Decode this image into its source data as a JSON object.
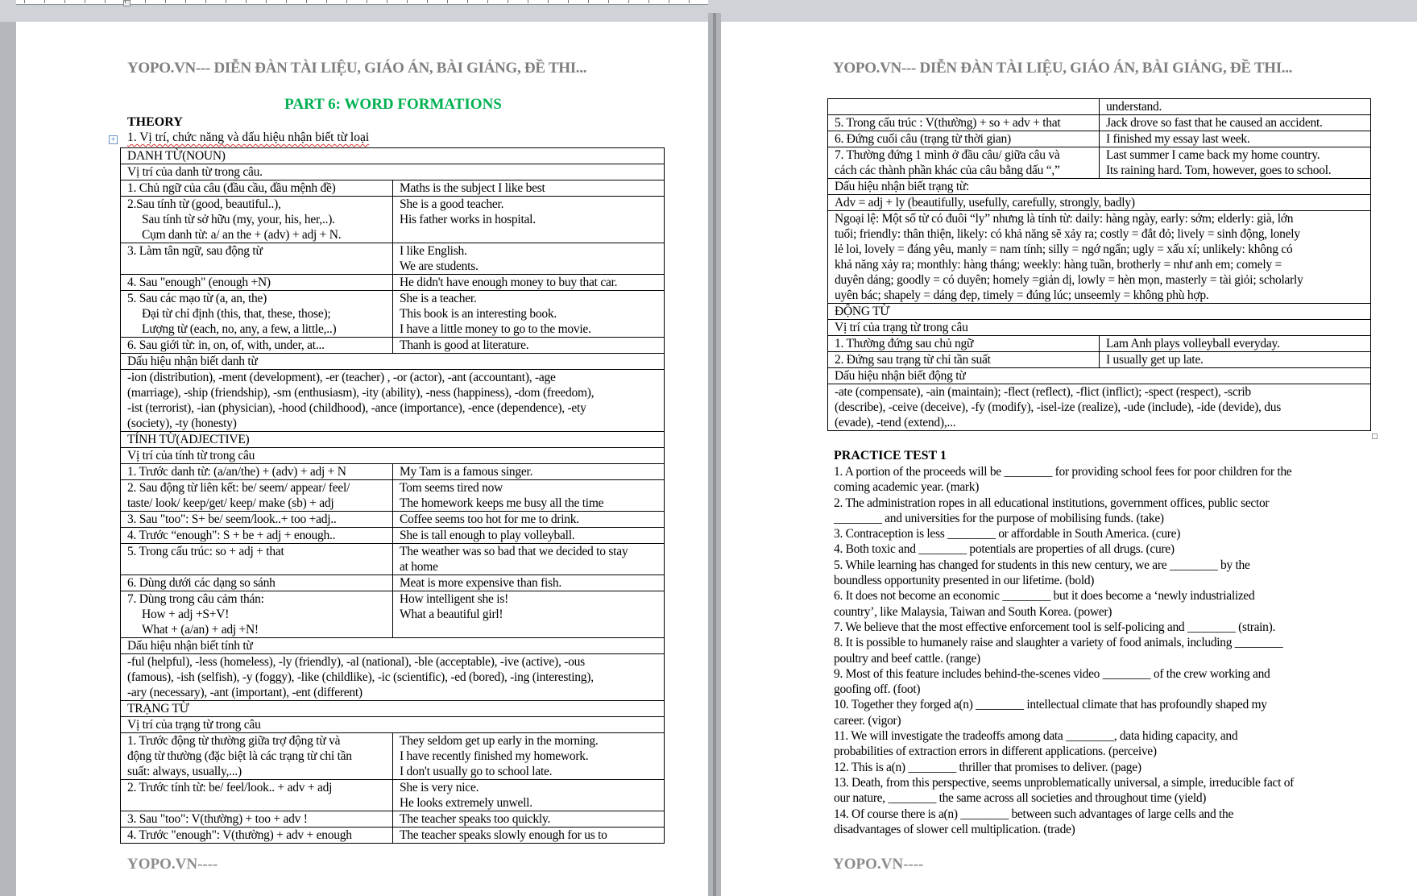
{
  "header_text": "YOPO.VN--- DIỄN ĐÀN TÀI LIỆU, GIÁO ÁN, BÀI GIẢNG, ĐỀ THI...",
  "footer_text": "YOPO.VN----",
  "colors": {
    "title_green": "#00b050",
    "header_gray": "#7f7f7f",
    "spell_underline": "#e03030"
  },
  "left_page": {
    "title": "PART 6: WORD FORMATIONS",
    "theory_label": "THEORY",
    "subheading": "1. Vị trí, chức năng và dấu hiệu nhận biết từ loại",
    "rows": [
      {
        "type": "full",
        "lines": [
          "DANH TỪ(NOUN)"
        ]
      },
      {
        "type": "full",
        "lines": [
          "Vị trí của danh từ trong câu."
        ]
      },
      {
        "type": "pair",
        "left": [
          "1. Chủ ngữ của câu (đầu cầu, đầu mệnh đề)"
        ],
        "right": [
          "Maths is the subject I like best"
        ]
      },
      {
        "type": "pair",
        "left": [
          "2.Sau tính từ (good, beautiful..),",
          "Sau tính từ sở hữu (my, your, his, her,..).",
          "Cụm danh từ: a/ an the + (adv) + adj + N."
        ],
        "right": [
          "She is a good teacher.",
          "His father works in hospital."
        ]
      },
      {
        "type": "pair",
        "left": [
          "3. Làm tân ngữ, sau động từ"
        ],
        "right": [
          "I like English.",
          "We are students."
        ]
      },
      {
        "type": "pair",
        "left": [
          "4. Sau \"enough\" (enough +N)"
        ],
        "right": [
          "He didn't have enough money to buy that car."
        ]
      },
      {
        "type": "pair",
        "left": [
          "5. Sau các mạo từ (a, an, the)",
          "Đại từ chỉ định (this, that, these, those);",
          "Lượng từ (each, no, any, a few, a little,..)"
        ],
        "right": [
          "She is a teacher.",
          "This book is an interesting book.",
          "I have a little money to go to the movie."
        ]
      },
      {
        "type": "pair",
        "left": [
          "6. Sau giới từ: in, on, of, with, under, at..."
        ],
        "right": [
          "Thanh is good at literature."
        ]
      },
      {
        "type": "full",
        "lines": [
          "Dấu hiệu nhận biết danh từ"
        ]
      },
      {
        "type": "full",
        "lines": [
          "-ion (distribution), -ment (development), -er (teacher) , -or (actor), -ant (accountant), -age",
          "(marriage), -ship (friendship), -sm (enthusiasm), -ity (ability), -ness (happiness), -dom (freedom),",
          "-ist (terrorist), -ian (physician), -hood (childhood), -ance (importance), -ence (dependence), -ety",
          "(society), -ty (honesty)"
        ]
      },
      {
        "type": "full",
        "lines": [
          "TÍNH TỪ(ADJECTIVE)"
        ]
      },
      {
        "type": "full",
        "lines": [
          "Vị trí của tính từ trong câu"
        ]
      },
      {
        "type": "pair",
        "left": [
          "1. Trước danh từ: (a/an/the) + (adv) + adj + N"
        ],
        "right": [
          "My Tam is a famous singer."
        ]
      },
      {
        "type": "pair",
        "left": [
          "2. Sau động từ liên kết: be/ seem/ appear/ feel/",
          "taste/ look/ keep/get/ keep/ make (sb) + adj"
        ],
        "right": [
          "Tom seems tired now",
          "The homework keeps me busy all the time"
        ]
      },
      {
        "type": "pair",
        "left": [
          "3. Sau \"too\": S+ be/ seem/look..+ too +adj.."
        ],
        "right": [
          "Coffee seems too hot for me to drink."
        ]
      },
      {
        "type": "pair",
        "left": [
          "4. Trước “enough\": S + be + adj + enough.."
        ],
        "right": [
          "She is tall enough to play volleyball."
        ]
      },
      {
        "type": "pair",
        "left": [
          "5. Trong cấu trúc: so + adj + that"
        ],
        "right": [
          "The weather was so bad that we decided to stay",
          "at home"
        ]
      },
      {
        "type": "pair",
        "left": [
          "6. Dùng dưới các dạng so sánh"
        ],
        "right": [
          "Meat is more expensive than fish."
        ]
      },
      {
        "type": "pair",
        "left": [
          "7. Dùng trong câu cảm thán:",
          "How + adj +S+V!",
          "What + (a/an) + adj +N!"
        ],
        "right": [
          "How intelligent she is!",
          "What a beautiful girl!"
        ]
      },
      {
        "type": "full",
        "lines": [
          "Dấu hiệu nhận biết tính từ"
        ]
      },
      {
        "type": "full",
        "lines": [
          "-ful (helpful), -less (homeless), -ly (friendly), -al (national), -ble (acceptable), -ive (active), -ous",
          "(famous), -ish (selfish), -y (foggy), -like (childlike), -ic (scientific), -ed (bored), -ing (interesting),",
          "-ary (necessary), -ant (important), -ent (different)"
        ]
      },
      {
        "type": "full",
        "lines": [
          "TRẠNG TỪ"
        ]
      },
      {
        "type": "full",
        "lines": [
          "Vị trí của trạng từ trong câu"
        ]
      },
      {
        "type": "pair",
        "left": [
          "1. Trước động từ thường giữa trợ động từ và",
          "động từ thường (đặc biệt là các trạng từ chỉ tần",
          "suất: always, usually,...)"
        ],
        "right": [
          "They seldom get up early in the morning.",
          "I have recently finished my homework.",
          "I don't usually go to school late."
        ]
      },
      {
        "type": "pair",
        "left": [
          "2. Trước tính từ: be/ feel/look.. + adv + adj"
        ],
        "right": [
          "She is very nice.",
          "He looks extremely unwell."
        ]
      },
      {
        "type": "pair",
        "left": [
          "3. Sau \"too\": V(thường) + too + adv !"
        ],
        "right": [
          "The teacher speaks too quickly."
        ]
      },
      {
        "type": "pair",
        "left": [
          "4. Trước \"enough\": V(thường) + adv + enough"
        ],
        "right": [
          "The teacher speaks slowly enough for us to"
        ]
      }
    ]
  },
  "right_page": {
    "rows": [
      {
        "type": "pair",
        "left": [
          ""
        ],
        "right": [
          "understand."
        ]
      },
      {
        "type": "pair",
        "left": [
          "5. Trong cấu trúc : V(thường) + so + adv + that"
        ],
        "right": [
          "Jack drove so fast that he caused an accident."
        ]
      },
      {
        "type": "pair",
        "left": [
          "6. Đứng cuối câu (trạng từ thời gian)"
        ],
        "right": [
          "I finished my essay last week."
        ]
      },
      {
        "type": "pair",
        "left": [
          "7. Thường đứng 1 mình ở đầu câu/ giữa câu và",
          "cách các thành phần khác của câu bằng dấu “,”"
        ],
        "right": [
          "Last summer I came back my home country.",
          "Its raining hard. Tom, however, goes to school."
        ]
      },
      {
        "type": "full",
        "lines": [
          "Dấu hiệu nhận biết trạng từ:"
        ]
      },
      {
        "type": "full",
        "lines": [
          "Adv = adj + ly (beautifully, usefully, carefully, strongly, badly)"
        ]
      },
      {
        "type": "full",
        "lines": [
          "Ngoại lệ: Một số từ có đuôi “ly” nhưng là tính từ: daily: hàng ngày, early: sớm; elderly: già, lớn",
          "tuổi; friendly: thân thiện, likely: có khả năng sẽ xảy ra; costly = đắt đỏ; lively = sinh động, lonely",
          "lẻ loi, lovely = đáng yêu, manly = nam tính; silly = ngớ ngẩn; ugly = xấu xí; unlikely: không có",
          "khả năng xảy ra; monthly: hàng tháng; weekly: hàng tuần, brotherly = như anh em; comely =",
          "duyên dáng; goodly = có duyên; homely =giản dị, lowly = hèn mọn, masterly = tài giỏi; scholarly",
          "uyên bác; shapely = dáng đẹp, timely = đúng lúc; unseemly = không phù hợp."
        ]
      },
      {
        "type": "full",
        "lines": [
          "ĐỘNG TỪ"
        ]
      },
      {
        "type": "full",
        "lines": [
          "Vị trí của trạng từ trong câu"
        ]
      },
      {
        "type": "pair",
        "left": [
          "1. Thường đứng sau chủ ngữ"
        ],
        "right": [
          "Lam Anh plays volleyball everyday."
        ]
      },
      {
        "type": "pair",
        "left": [
          "2. Đứng sau trạng từ chỉ tần suất"
        ],
        "right": [
          "I usually get up late."
        ]
      },
      {
        "type": "full",
        "lines": [
          "Dấu hiệu nhận biết động từ"
        ]
      },
      {
        "type": "full",
        "lines": [
          "-ate (compensate), -ain (maintain); -flect (reflect), -flict (inflict); -spect (respect), -scrib",
          "(describe), -ceive (deceive), -fy (modify), -isel-ize (realize), -ude (include), -ide (devide), dus",
          "(evade), -tend (extend),..."
        ]
      }
    ],
    "practice_title": "PRACTICE TEST 1",
    "questions": [
      [
        " 1. A portion of the proceeds will be ________ for providing school fees for poor children for the",
        "coming academic year. (mark)"
      ],
      [
        "2. The administration ropes in all educational institutions, government offices, public sector",
        "________ and universities for the purpose of mobilising funds. (take)"
      ],
      [
        "3. Contraception is less ________ or affordable in South America. (cure)"
      ],
      [
        "4. Both toxic and ________ potentials are properties of all drugs. (cure)"
      ],
      [
        "5. While learning has changed for students in this new century, we are ________ by the",
        "boundless opportunity presented in our lifetime. (bold)"
      ],
      [
        "6. It does not become an economic ________ but it does become a ‘newly industrialized",
        "country’, like Malaysia, Taiwan and South Korea. (power)"
      ],
      [
        "7. We believe that the most effective enforcement tool is self-policing and ________ (strain)."
      ],
      [
        "8. It is possible to humanely raise and slaughter a variety of food animals, including ________",
        "poultry and beef cattle. (range)"
      ],
      [
        "9. Most of this feature includes behind-the-scenes video ________ of the crew working and",
        "goofing off. (foot)"
      ],
      [
        "10. Together they forged a(n) ________ intellectual climate that has profoundly shaped my",
        "career. (vigor)"
      ],
      [
        "11. We will investigate the tradeoffs among data ________, data hiding capacity, and",
        "probabilities of extraction errors in different applications. (perceive)"
      ],
      [
        "12. This is a(n) ________ thriller that promises to deliver. (page)"
      ],
      [
        "13. Death, from this perspective, seems unproblematically universal, a simple, irreducible fact of",
        "our nature, ________ the same across all societies and throughout time (yield)"
      ],
      [
        "14. Of course there is a(n) ________ between such advantages of large cells and the",
        "disadvantages of slower cell multiplication. (trade)"
      ]
    ]
  }
}
